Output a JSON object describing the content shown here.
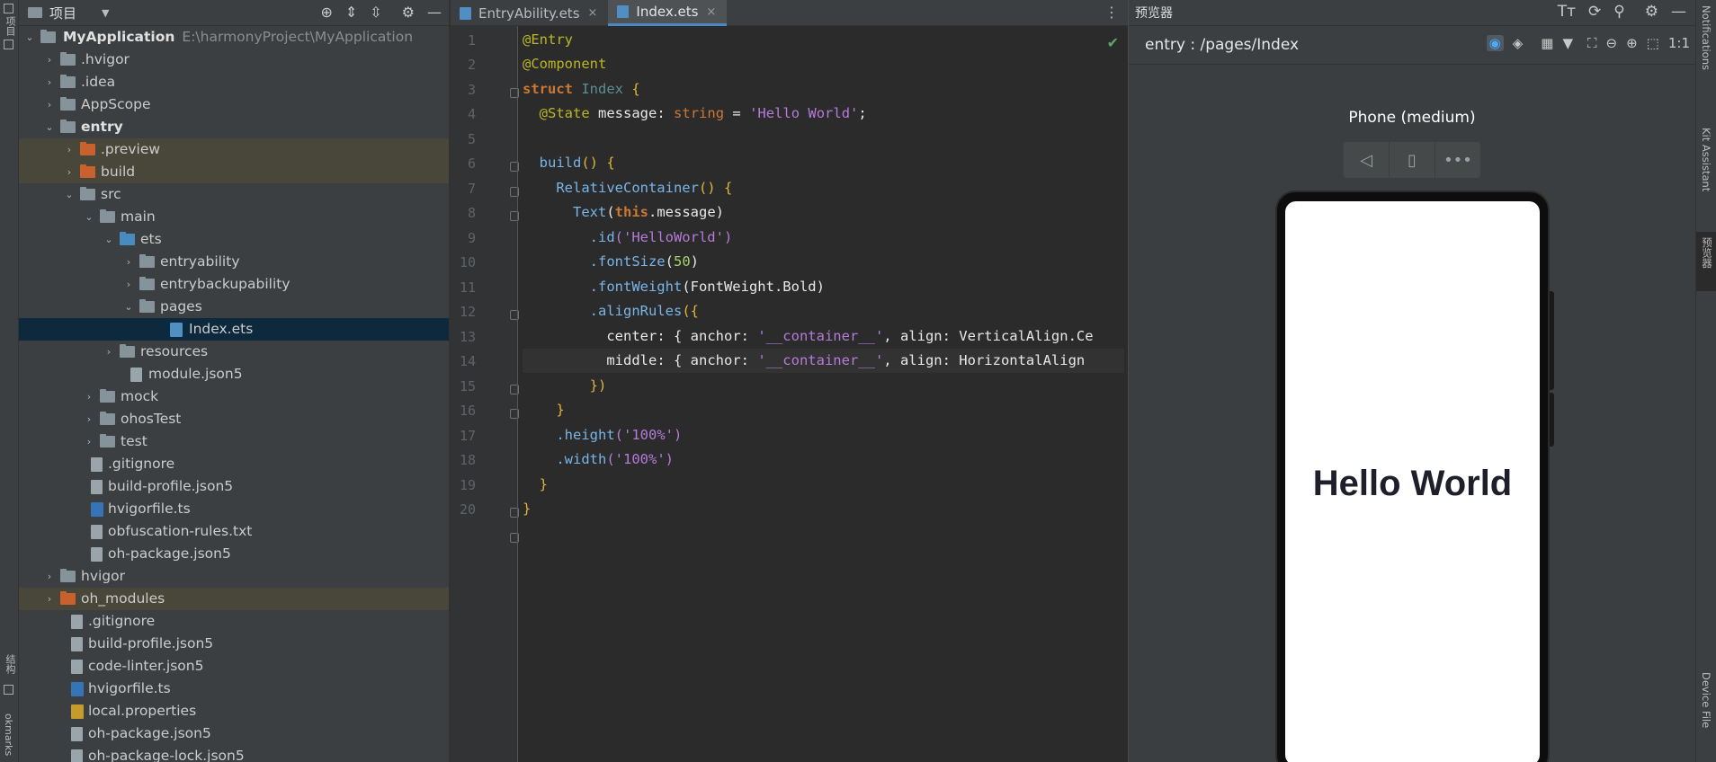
{
  "left_strip": {
    "project_label": "项目",
    "structure_label": "结构",
    "bookmarks_label": "okmarks"
  },
  "project_panel": {
    "title": "项目",
    "tool_icons": [
      "target-icon",
      "expand-icon",
      "collapse-icon",
      "gear-icon",
      "minimize-icon"
    ],
    "tree": [
      {
        "label": "MyApplication",
        "path": "E:\\harmonyProject\\MyApplication"
      },
      {
        "label": ".hvigor"
      },
      {
        "label": ".idea"
      },
      {
        "label": "AppScope"
      },
      {
        "label": "entry"
      },
      {
        "label": ".preview"
      },
      {
        "label": "build"
      },
      {
        "label": "src"
      },
      {
        "label": "main"
      },
      {
        "label": "ets"
      },
      {
        "label": "entryability"
      },
      {
        "label": "entrybackupability"
      },
      {
        "label": "pages"
      },
      {
        "label": "Index.ets"
      },
      {
        "label": "resources"
      },
      {
        "label": "module.json5"
      },
      {
        "label": "mock"
      },
      {
        "label": "ohosTest"
      },
      {
        "label": "test"
      },
      {
        "label": ".gitignore"
      },
      {
        "label": "build-profile.json5"
      },
      {
        "label": "hvigorfile.ts"
      },
      {
        "label": "obfuscation-rules.txt"
      },
      {
        "label": "oh-package.json5"
      },
      {
        "label": "hvigor"
      },
      {
        "label": "oh_modules"
      },
      {
        "label": ".gitignore"
      },
      {
        "label": "build-profile.json5"
      },
      {
        "label": "code-linter.json5"
      },
      {
        "label": "hvigorfile.ts"
      },
      {
        "label": "local.properties"
      },
      {
        "label": "oh-package.json5"
      },
      {
        "label": "oh-package-lock.json5"
      }
    ]
  },
  "editor": {
    "tabs": [
      {
        "label": "EntryAbility.ets",
        "close": "×"
      },
      {
        "label": "Index.ets",
        "close": "×"
      }
    ],
    "more": "⋮",
    "line_numbers": [
      "1",
      "2",
      "3",
      "4",
      "5",
      "6",
      "7",
      "8",
      "9",
      "10",
      "11",
      "12",
      "13",
      "14",
      "15",
      "16",
      "17",
      "18",
      "19",
      "20"
    ],
    "code": {
      "l1": "@Entry",
      "l2": "@Component",
      "l3_kw": "struct",
      "l3_name": "Index",
      "l3_brace": "{",
      "l4_ann": "@State",
      "l4_var": "message",
      "l4_colon": ":",
      "l4_type": "string",
      "l4_eq": "=",
      "l4_val": "'Hello World'",
      "l4_semi": ";",
      "l6_fn": "build",
      "l6_rest": "() {",
      "l7_fn": "RelativeContainer",
      "l7_rest": "() {",
      "l8_fn": "Text",
      "l8_open": "(",
      "l8_this": "this",
      "l8_prop": ".message",
      "l8_close": ")",
      "l9_m": ".id",
      "l9_arg": "('HelloWorld')",
      "l10_m": ".fontSize",
      "l10_open": "(",
      "l10_num": "50",
      "l10_close": ")",
      "l11_m": ".fontWeight",
      "l11_arg": "(FontWeight.Bold)",
      "l12_m": ".alignRules",
      "l12_arg": "({",
      "l13_key": "center",
      "l13_mid": ": { anchor: ",
      "l13_str": "'__container__'",
      "l13_rest": ", align: VerticalAlign.Ce",
      "l14_key": "middle",
      "l14_mid": ": { anchor: ",
      "l14_str": "'__container__'",
      "l14_rest": ", align: HorizontalAlign",
      "l15": "})",
      "l16": "}",
      "l17_m": ".height",
      "l17_arg": "('100%')",
      "l18_m": ".width",
      "l18_arg": "('100%')",
      "l19": "}",
      "l20": "}"
    },
    "status_icon": "check-icon"
  },
  "previewer": {
    "title": "预览器",
    "route": "entry : /pages/Index",
    "device": "Phone (medium)",
    "screen_text": "Hello World",
    "zoom_label": "1:1"
  },
  "right_strip": {
    "notifications": "Notifications",
    "kit_assistant": "Kit Assistant",
    "previewer": "预览器",
    "device_file": "Device File"
  }
}
